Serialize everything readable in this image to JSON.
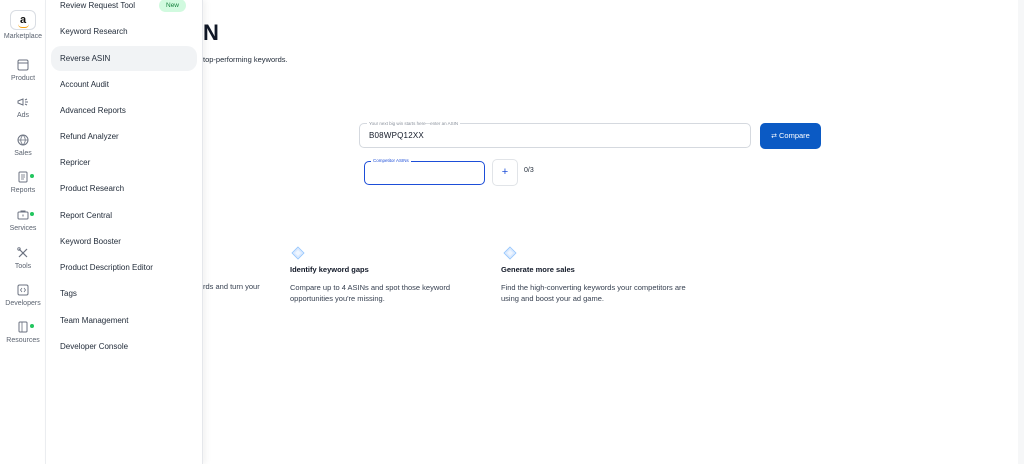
{
  "rail": {
    "items": [
      {
        "label": "Marketplace",
        "icon": "amazon-logo-icon"
      },
      {
        "label": "Product",
        "icon": "product-box-icon"
      },
      {
        "label": "Ads",
        "icon": "megaphone-icon"
      },
      {
        "label": "Sales",
        "icon": "globe-icon"
      },
      {
        "label": "Reports",
        "icon": "document-icon"
      },
      {
        "label": "Services",
        "icon": "briefcase-icon"
      },
      {
        "label": "Tools",
        "icon": "tools-icon"
      },
      {
        "label": "Developers",
        "icon": "code-icon"
      },
      {
        "label": "Resources",
        "icon": "book-icon"
      }
    ],
    "logo_letter": "a"
  },
  "menu": {
    "items": [
      {
        "label": "Review Request Tool",
        "badge": "New"
      },
      {
        "label": "Keyword Research"
      },
      {
        "label": "Reverse ASIN"
      },
      {
        "label": "Account Audit"
      },
      {
        "label": "Advanced Reports"
      },
      {
        "label": "Refund Analyzer"
      },
      {
        "label": "Repricer"
      },
      {
        "label": "Product Research"
      },
      {
        "label": "Report Central"
      },
      {
        "label": "Keyword Booster"
      },
      {
        "label": "Product Description Editor"
      },
      {
        "label": "Tags"
      },
      {
        "label": "Team Management"
      },
      {
        "label": "Developer Console"
      }
    ]
  },
  "main": {
    "title_fragment": "N",
    "subtitle_fragment": "top-performing keywords.",
    "asin_field": {
      "label": "Your next big win starts here—enter an ASIN",
      "value": "B08WPQ12XX"
    },
    "compare_label": "Compare",
    "competitor_field": {
      "label": "Competitor ASINs",
      "value": ""
    },
    "add_label": "+",
    "count": "0/3",
    "feature_fragment": "rds and turn your",
    "features": [
      {
        "title": "Identify keyword gaps",
        "desc": "Compare up to 4 ASINs and spot those keyword opportunities you're missing.",
        "icon": "diamond-icon"
      },
      {
        "title": "Generate more sales",
        "desc": "Find the high-converting keywords your competitors are using and boost your ad game.",
        "icon": "diamond-icon"
      }
    ]
  },
  "colors": {
    "accent": "#0b5ac4",
    "badge_bg": "#d1fadf",
    "badge_text": "#15803d",
    "status_dot": "#22c55e"
  }
}
